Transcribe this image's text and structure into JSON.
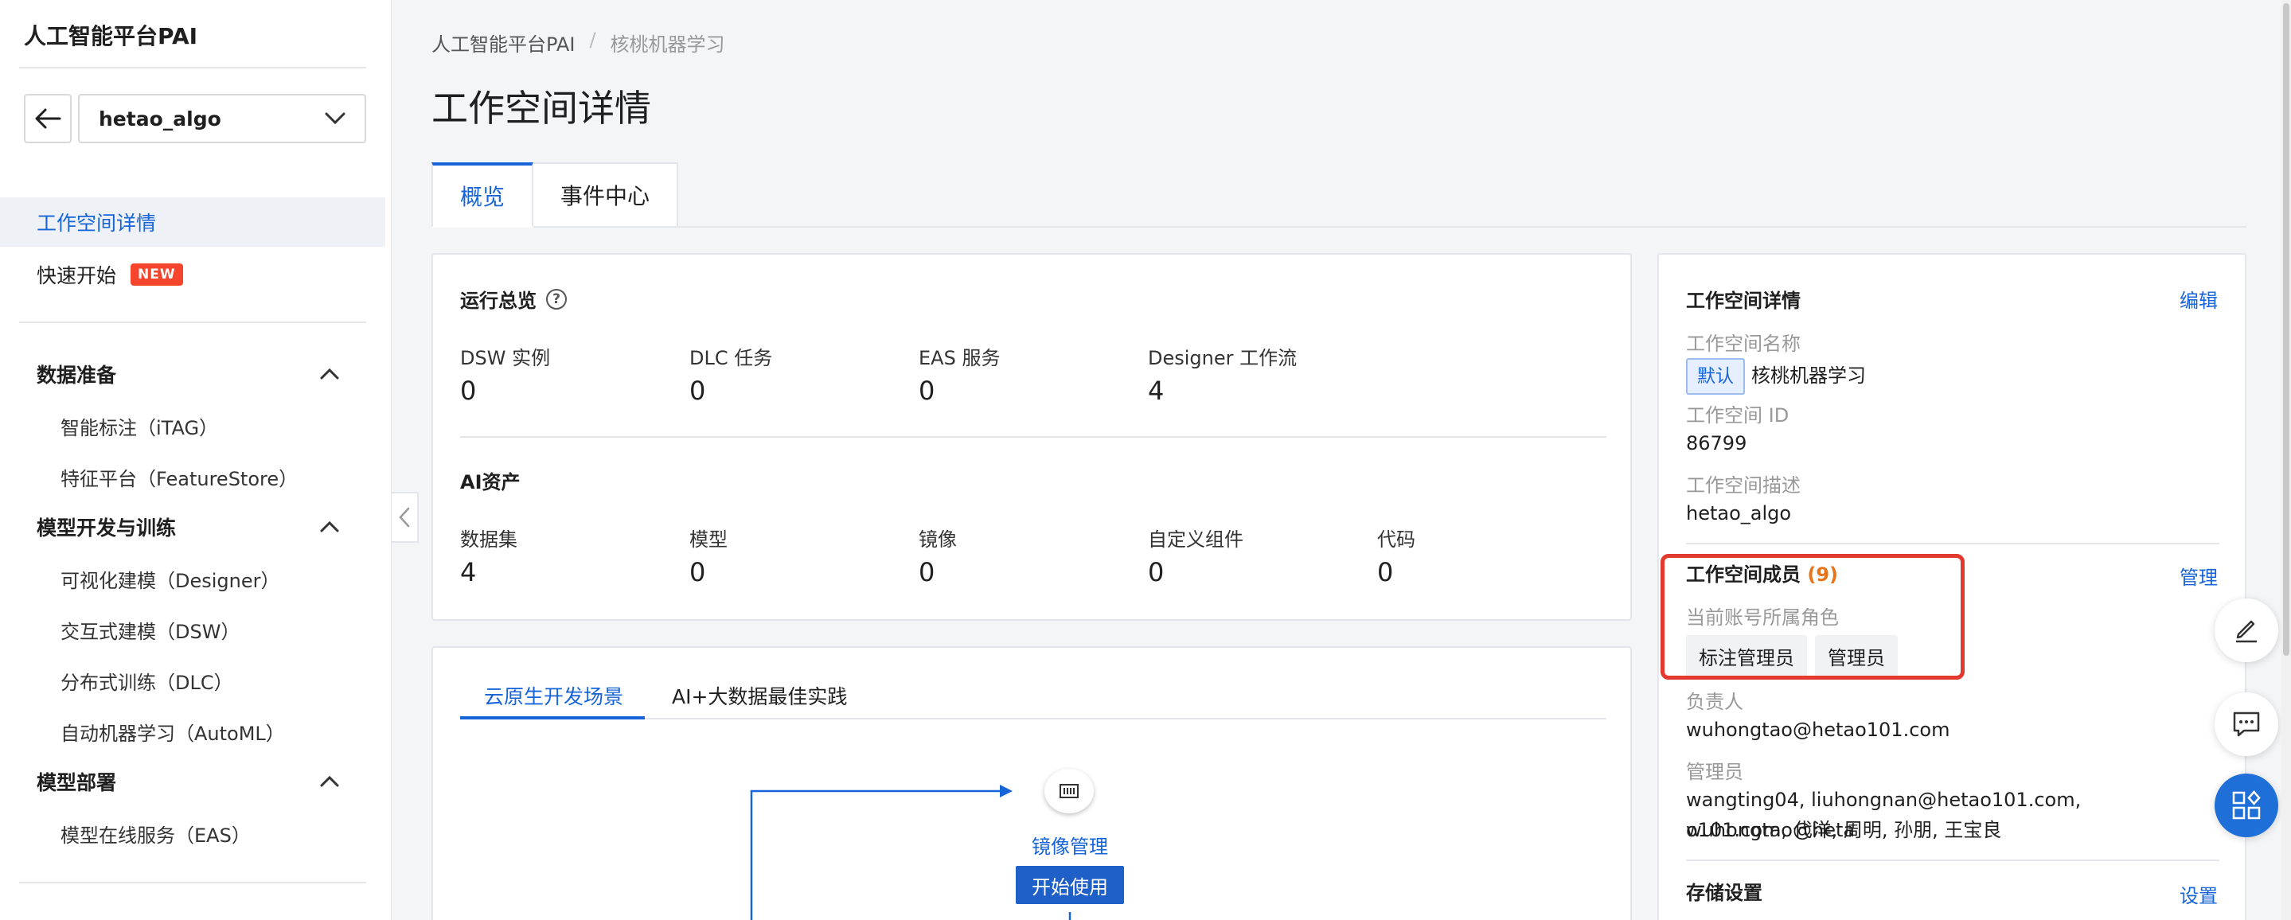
{
  "sidebar": {
    "brand": "人工智能平台PAI",
    "workspace_select": "hetao_algo",
    "items": [
      {
        "label": "工作空间详情",
        "active": true
      },
      {
        "label": "快速开始",
        "badge": "NEW"
      }
    ],
    "groups": [
      {
        "title": "数据准备",
        "items": [
          "智能标注（iTAG）",
          "特征平台（FeatureStore）"
        ]
      },
      {
        "title": "模型开发与训练",
        "items": [
          "可视化建模（Designer）",
          "交互式建模（DSW）",
          "分布式训练（DLC）",
          "自动机器学习（AutoML）"
        ]
      },
      {
        "title": "模型部署",
        "items": [
          "模型在线服务（EAS）"
        ]
      }
    ]
  },
  "breadcrumb": {
    "root": "人工智能平台PAI",
    "sep": "/",
    "current": "核桃机器学习"
  },
  "page_title": "工作空间详情",
  "tabs": [
    "概览",
    "事件中心"
  ],
  "overview": {
    "running_title": "运行总览",
    "help_glyph": "?",
    "running_stats": [
      {
        "label": "DSW 实例",
        "value": "0"
      },
      {
        "label": "DLC 任务",
        "value": "0"
      },
      {
        "label": "EAS 服务",
        "value": "0"
      },
      {
        "label": "Designer 工作流",
        "value": "4"
      }
    ],
    "assets_title": "AI资产",
    "asset_stats": [
      {
        "label": "数据集",
        "value": "4"
      },
      {
        "label": "模型",
        "value": "0"
      },
      {
        "label": "镜像",
        "value": "0"
      },
      {
        "label": "自定义组件",
        "value": "0"
      },
      {
        "label": "代码",
        "value": "0"
      }
    ]
  },
  "scenes": {
    "tabs": [
      "云原生开发场景",
      "AI+大数据最佳实践"
    ],
    "node_label": "镜像管理",
    "node_button": "开始使用"
  },
  "detail": {
    "title": "工作空间详情",
    "edit": "编辑",
    "name_label": "工作空间名称",
    "default_tag": "默认",
    "name_value": "核桃机器学习",
    "id_label": "工作空间 ID",
    "id_value": "86799",
    "desc_label": "工作空间描述",
    "desc_value": "hetao_algo",
    "members_title": "工作空间成员",
    "members_count": "(9)",
    "manage": "管理",
    "role_label": "当前账号所属角色",
    "roles": [
      "标注管理员",
      "管理员"
    ],
    "owner_label": "负责人",
    "owner_value": "wuhongtao@hetao101.com",
    "admins_label": "管理员",
    "admins_line1": "wangting04, liuhongnan@hetao101.com, wuhongtao@heta",
    "admins_line2": "o101.com, 代洋, 周明, 孙朋, 王宝良",
    "storage_title": "存储设置",
    "storage_link": "设置"
  },
  "colors": {
    "accent": "#1664d8",
    "highlight": "#e23a2e",
    "badge": "#f5462d",
    "count": "#e8741a"
  }
}
